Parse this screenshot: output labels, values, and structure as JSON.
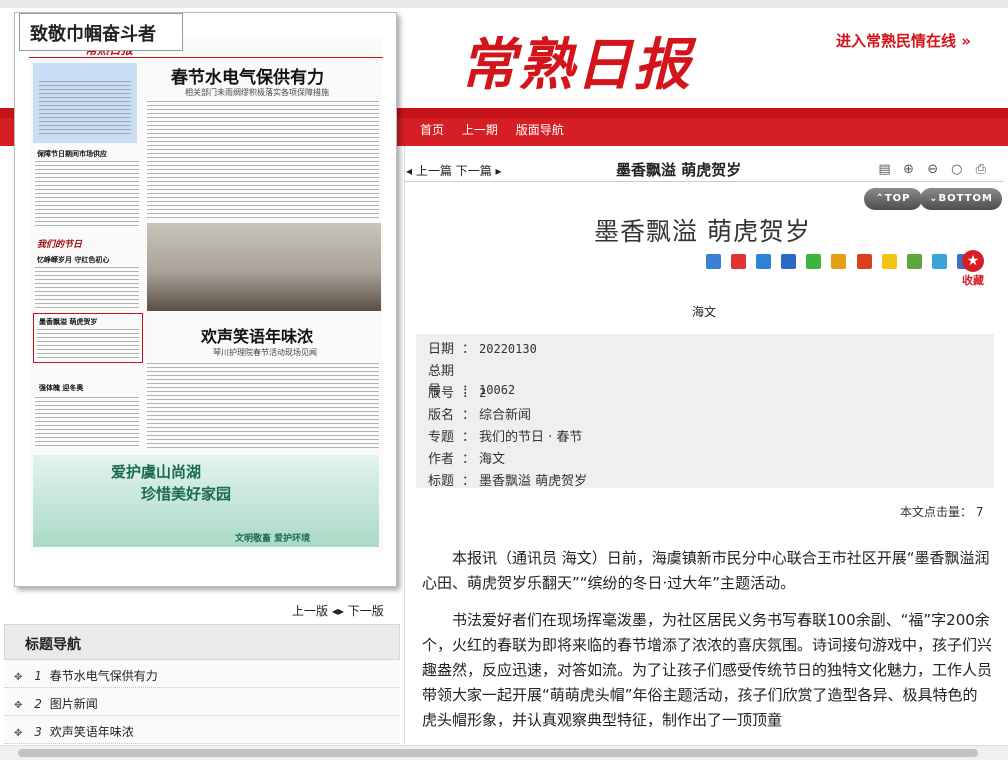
{
  "header": {
    "logo": "常熟日报",
    "promo": "进入常熟民情在线",
    "promo_arrow": "»",
    "nav": [
      "首页",
      "上一期",
      "版面导航"
    ]
  },
  "paper": {
    "label": "致敬巾帼奋斗者",
    "masthead": "常熟日报",
    "headline1": "春节水电气保供有力",
    "subhead1": "相关部门未雨绸缪积极落实各项保障措施",
    "headline2": "欢声笑语年味浓",
    "subhead2": "琴川护理院春节活动现场见闻",
    "left_head1": "保障节日期间市场供应",
    "left_head2": "我们的节日",
    "left_head3": "忆峥嵘岁月  守红色初心",
    "left_head4": "墨香飘溢 萌虎贺岁",
    "left_head5": "强体魄  迎冬奥",
    "ad_line1": "爱护虞山尚湖",
    "ad_line2": "珍惜美好家园",
    "ad_line3": "文明敬畜  爱护环境"
  },
  "pager": {
    "prev": "上一版",
    "next": "下一版"
  },
  "toc": {
    "head": "标题导航",
    "items": [
      {
        "num": "1",
        "title": "春节水电气保供有力"
      },
      {
        "num": "2",
        "title": "图片新闻"
      },
      {
        "num": "3",
        "title": "欢声笑语年味浓"
      }
    ]
  },
  "article_bar": {
    "prev": "上一篇",
    "next": "下一篇",
    "title": "墨香飘溢 萌虎贺岁"
  },
  "buttons": {
    "top": "TOP",
    "bottom": "BOTTOM",
    "collect": "收藏"
  },
  "article": {
    "title": "墨香飘溢 萌虎贺岁",
    "author": "海文",
    "meta": {
      "date_label": "日期",
      "date": "20220130",
      "issue_label": "总期号",
      "issue": "10062",
      "page_label": "版号",
      "page": "2",
      "section_label": "版名",
      "section": "综合新闻",
      "topic_label": "专题",
      "topic": "我们的节日 · 春节",
      "author_label": "作者",
      "author": "海文",
      "title_label": "标题",
      "title": "墨香飘溢 萌虎贺岁"
    },
    "hits_label": "本文点击量：",
    "hits": "7",
    "paragraphs": [
      "本报讯（通讯员 海文）日前，海虞镇新市民分中心联合王市社区开展“墨香飘溢润心田、萌虎贺岁乐翻天”“缤纷的冬日·过大年”主题活动。",
      "书法爱好者们在现场挥毫泼墨，为社区居民义务书写春联100余副、“福”字200余个，火红的春联为即将来临的春节增添了浓浓的喜庆氛围。诗词接句游戏中，孩子们兴趣盎然，反应迅速，对答如流。为了让孩子们感受传统节日的独特文化魅力，工作人员带领大家一起开展“萌萌虎头帽”年俗主题活动，孩子们欣赏了造型各异、极具特色的虎头帽形象，并认真观察典型特征，制作出了一顶顶童"
    ]
  },
  "colors": {
    "brand_red": "#d61f24",
    "meta_bg": "#efefef"
  }
}
